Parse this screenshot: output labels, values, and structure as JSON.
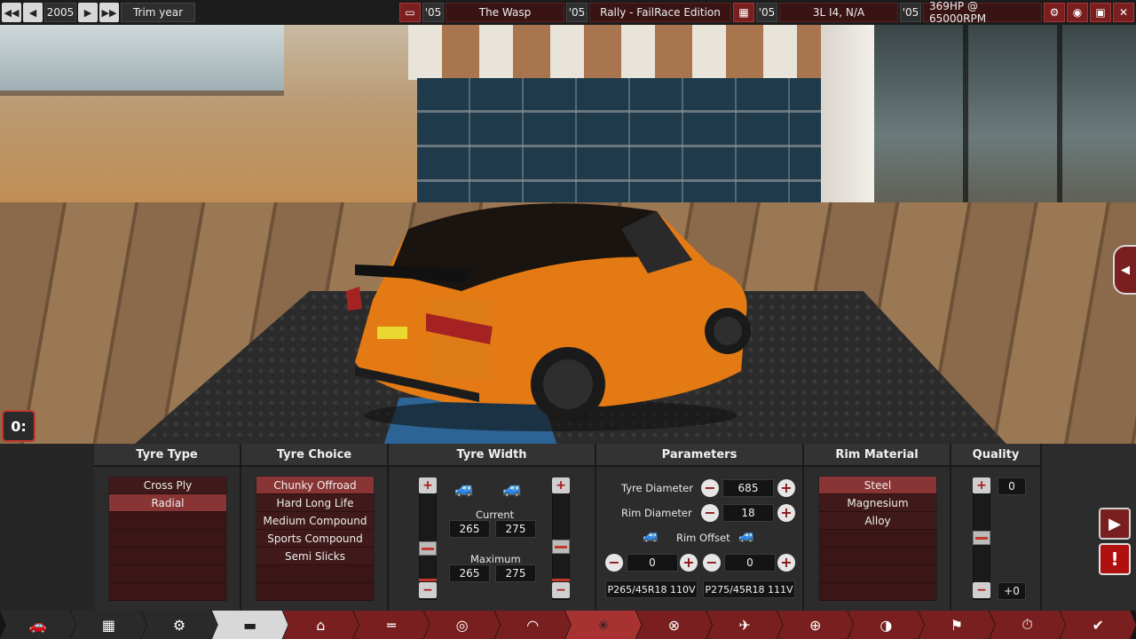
{
  "topbar": {
    "year": "2005",
    "trim_label": "Trim year",
    "model_year": "'05",
    "model_name": "The Wasp",
    "trim_year": "'05",
    "trim_name": "Rally - FailRace Edition",
    "engine_year": "'05",
    "engine_name": "3L I4, N/A",
    "variant_year": "'05",
    "power": "369HP @ 65000RPM",
    "prev_fast_icon": "rewind-icon",
    "prev_icon": "triangle-left-icon",
    "next_icon": "triangle-right-icon",
    "next_fast_icon": "fast-forward-icon",
    "settings_icon": "gear-icon",
    "camera_icon": "camera-icon",
    "save_icon": "floppy-disk-icon",
    "close_icon": "close-icon"
  },
  "panel": {
    "tyre_type": {
      "title": "Tyre Type",
      "items": [
        {
          "label": "Cross Ply",
          "selected": false
        },
        {
          "label": "Radial",
          "selected": true
        }
      ]
    },
    "tyre_choice": {
      "title": "Tyre Choice",
      "items": [
        {
          "label": "Chunky Offroad",
          "selected": true
        },
        {
          "label": "Hard Long Life",
          "selected": false
        },
        {
          "label": "Medium Compound",
          "selected": false
        },
        {
          "label": "Sports Compound",
          "selected": false
        },
        {
          "label": "Semi Slicks",
          "selected": false
        }
      ]
    },
    "tyre_width": {
      "title": "Tyre Width",
      "current_label": "Current",
      "maximum_label": "Maximum",
      "current_front": "265",
      "current_rear": "275",
      "maximum_front": "265",
      "maximum_rear": "275",
      "front_slider_level": 0.35,
      "rear_slider_level": 0.37
    },
    "parameters": {
      "title": "Parameters",
      "tyre_diameter_label": "Tyre Diameter",
      "tyre_diameter": "685",
      "rim_diameter_label": "Rim Diameter",
      "rim_diameter": "18",
      "rim_offset_label": "Rim Offset",
      "rim_offset_front": "0",
      "rim_offset_rear": "0",
      "tyre_code_front": "P265/45R18 110V",
      "tyre_code_rear": "P275/45R18 111V"
    },
    "rim_material": {
      "title": "Rim Material",
      "items": [
        {
          "label": "Steel",
          "selected": true
        },
        {
          "label": "Magnesium",
          "selected": false
        },
        {
          "label": "Alloy",
          "selected": false
        }
      ]
    },
    "quality": {
      "title": "Quality",
      "value": "0",
      "cost": "+0",
      "slider_level": 0.5
    }
  },
  "navbar": {
    "tabs": [
      {
        "icon": "car-body-icon",
        "glyph": "🚗"
      },
      {
        "icon": "engine-block-icon",
        "glyph": "▦"
      },
      {
        "icon": "engine-parts-icon",
        "glyph": "⚙"
      },
      {
        "icon": "car-design-icon",
        "glyph": "▬"
      },
      {
        "icon": "chassis-icon",
        "glyph": "⌂"
      },
      {
        "icon": "drivetrain-icon",
        "glyph": "═"
      },
      {
        "icon": "headlight-icon",
        "glyph": "◎"
      },
      {
        "icon": "brakes-icon",
        "glyph": "◠"
      },
      {
        "icon": "wheels-icon",
        "glyph": "✳"
      },
      {
        "icon": "suspension-icon",
        "glyph": "⊗"
      },
      {
        "icon": "aero-icon",
        "glyph": "✈"
      },
      {
        "icon": "interior-icon",
        "glyph": "⊕"
      },
      {
        "icon": "safety-icon",
        "glyph": "◑"
      },
      {
        "icon": "test-track-icon",
        "glyph": "⚑"
      },
      {
        "icon": "timing-icon",
        "glyph": "⏱"
      },
      {
        "icon": "confirm-icon",
        "glyph": "✔"
      }
    ]
  }
}
